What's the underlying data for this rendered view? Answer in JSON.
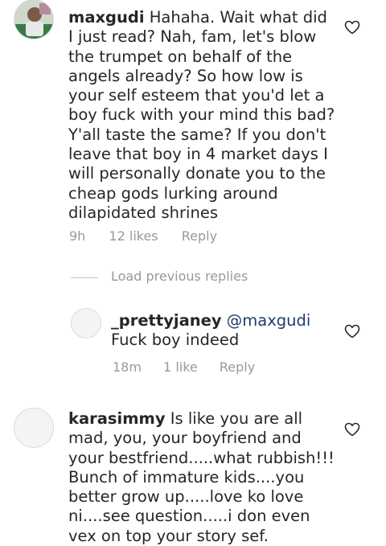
{
  "comments": [
    {
      "username": "maxgudi",
      "text": "Hahaha. Wait what did I just read? Nah, fam, let's blow the trumpet on behalf of the angels already? So how low is your self esteem that you'd let a boy fuck with your mind this bad? Y'all taste the same? If you don't leave that boy in 4 market days I will personally donate you to the cheap gods lurking around dilapidated shrines",
      "time": "9h",
      "likes": "12 likes",
      "reply_label": "Reply"
    },
    {
      "username": "karasimmy",
      "text": "Is like you are all mad, you, your boyfriend and your bestfriend.....what rubbish!!! Bunch of immature kids....you better grow up.....love ko love ni....see question.....i don even vex on top your story sef."
    }
  ],
  "load_previous": "Load previous replies",
  "reply": {
    "username": "_prettyjaney",
    "mention": "@maxgudi",
    "text": "Fuck boy indeed",
    "time": "18m",
    "likes": "1 like",
    "reply_label": "Reply"
  },
  "icons": {
    "like": "heart-outline-icon"
  },
  "colors": {
    "text": "#262626",
    "meta": "#999999",
    "mention": "#1e3e6b",
    "divider": "#c7c7c7"
  }
}
